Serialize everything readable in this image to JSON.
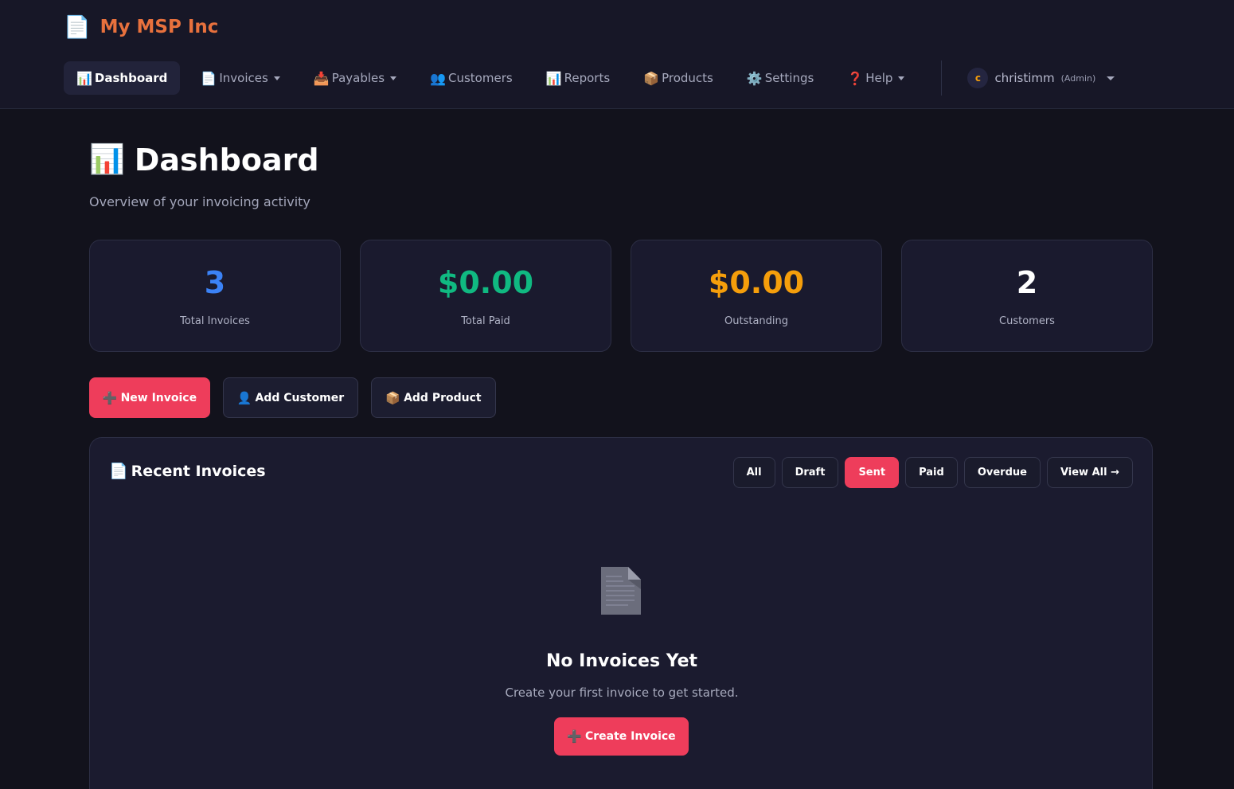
{
  "brand": {
    "icon": "document-icon",
    "name": "My MSP Inc",
    "color": "#e8713d"
  },
  "nav": {
    "items": [
      {
        "icon": "📊",
        "label": "Dashboard",
        "active": true
      },
      {
        "icon": "📄",
        "label": "Invoices",
        "dropdown": true
      },
      {
        "icon": "📥",
        "label": "Payables",
        "dropdown": true
      },
      {
        "icon": "👥",
        "label": "Customers"
      },
      {
        "icon": "📊",
        "label": "Reports"
      },
      {
        "icon": "📦",
        "label": "Products"
      },
      {
        "icon": "⚙️",
        "label": "Settings"
      },
      {
        "icon": "❓",
        "label": "Help",
        "dropdown": true
      }
    ],
    "user": {
      "initial": "c",
      "name": "christimm",
      "role": "(Admin)"
    }
  },
  "page": {
    "title_icon": "📊",
    "title": "Dashboard",
    "subtitle": "Overview of your invoicing activity"
  },
  "stats": [
    {
      "value": "3",
      "label": "Total Invoices",
      "color": "#3b82f6"
    },
    {
      "value": "$0.00",
      "label": "Total Paid",
      "color": "#10b981"
    },
    {
      "value": "$0.00",
      "label": "Outstanding",
      "color": "#f59e0b"
    },
    {
      "value": "2",
      "label": "Customers",
      "color": "#ffffff"
    }
  ],
  "actions": {
    "new_invoice": {
      "icon": "➕",
      "label": "New Invoice"
    },
    "add_customer": {
      "icon": "👤",
      "label": "Add Customer"
    },
    "add_product": {
      "icon": "📦",
      "label": "Add Product"
    }
  },
  "recent": {
    "icon": "📄",
    "title": "Recent Invoices",
    "filters": [
      "All",
      "Draft",
      "Sent",
      "Paid",
      "Overdue",
      "View All →"
    ],
    "active_filter": "Sent",
    "empty": {
      "title": "No Invoices Yet",
      "text": "Create your first invoice to get started.",
      "button_icon": "➕",
      "button_label": "Create Invoice"
    }
  },
  "colors": {
    "accent": "#ee3d5b",
    "background": "#12121c",
    "card": "#1a1a2e"
  }
}
